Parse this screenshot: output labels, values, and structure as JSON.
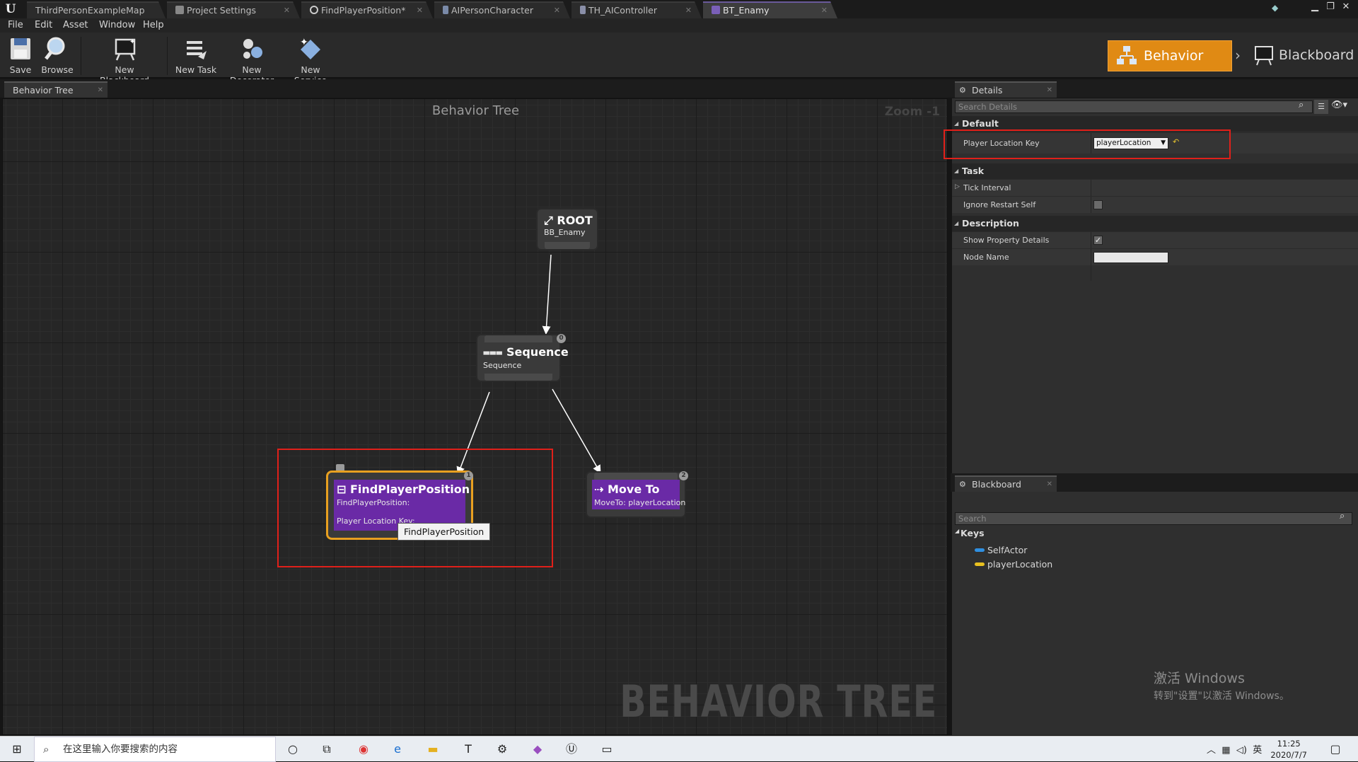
{
  "doc_tabs": [
    {
      "label": "ThirdPersonExampleMap"
    },
    {
      "label": "Project Settings"
    },
    {
      "label": "FindPlayerPosition*"
    },
    {
      "label": "AIPersonCharacter"
    },
    {
      "label": "TH_AIController"
    },
    {
      "label": "BT_Enamy"
    }
  ],
  "menu": [
    "File",
    "Edit",
    "Asset",
    "Window",
    "Help"
  ],
  "toolbar": {
    "save": "Save",
    "browse": "Browse",
    "new_blackboard": "New Blackboard",
    "new_task": "New Task",
    "new_decorator": "New Decorator",
    "new_service": "New Service"
  },
  "modes": {
    "behavior_tree": "Behavior Tree",
    "blackboard": "Blackboard"
  },
  "graph": {
    "tab": "Behavior Tree",
    "title": "Behavior Tree",
    "zoom": "Zoom -1",
    "watermark": "BEHAVIOR TREE",
    "nodes": {
      "root": {
        "title": "ROOT",
        "sub": "BB_Enamy"
      },
      "sequence": {
        "title": "Sequence",
        "sub": "Sequence",
        "index": "0"
      },
      "find": {
        "title": "FindPlayerPosition",
        "sub": "FindPlayerPosition:",
        "prop": "Player Location Key:",
        "index": "1"
      },
      "moveto": {
        "title": "Move To",
        "sub": "MoveTo: playerLocation",
        "index": "2"
      }
    },
    "tooltip": "FindPlayerPosition"
  },
  "details": {
    "tab": "Details",
    "search_placeholder": "Search Details",
    "categories": {
      "default": "Default",
      "task": "Task",
      "description": "Description"
    },
    "player_location_key_label": "Player Location Key",
    "player_location_key_value": "playerLocation",
    "tick_interval": "Tick Interval",
    "ignore_restart_self": "Ignore Restart Self",
    "ignore_restart_self_checked": false,
    "show_property_details": "Show Property Details",
    "show_property_details_checked": true,
    "node_name": "Node Name",
    "node_name_value": ""
  },
  "blackboard": {
    "tab": "Blackboard",
    "search_placeholder": "Search",
    "keys_header": "Keys",
    "keys": [
      {
        "name": "SelfActor",
        "color": "#2f8fe0"
      },
      {
        "name": "playerLocation",
        "color": "#e8c020"
      }
    ]
  },
  "activation": {
    "line1": "激活 Windows",
    "line2": "转到\"设置\"以激活 Windows。"
  },
  "taskbar": {
    "search_placeholder": "在这里输入你要搜索的内容",
    "ime": "英",
    "time": "11:25",
    "date": "2020/7/7"
  }
}
